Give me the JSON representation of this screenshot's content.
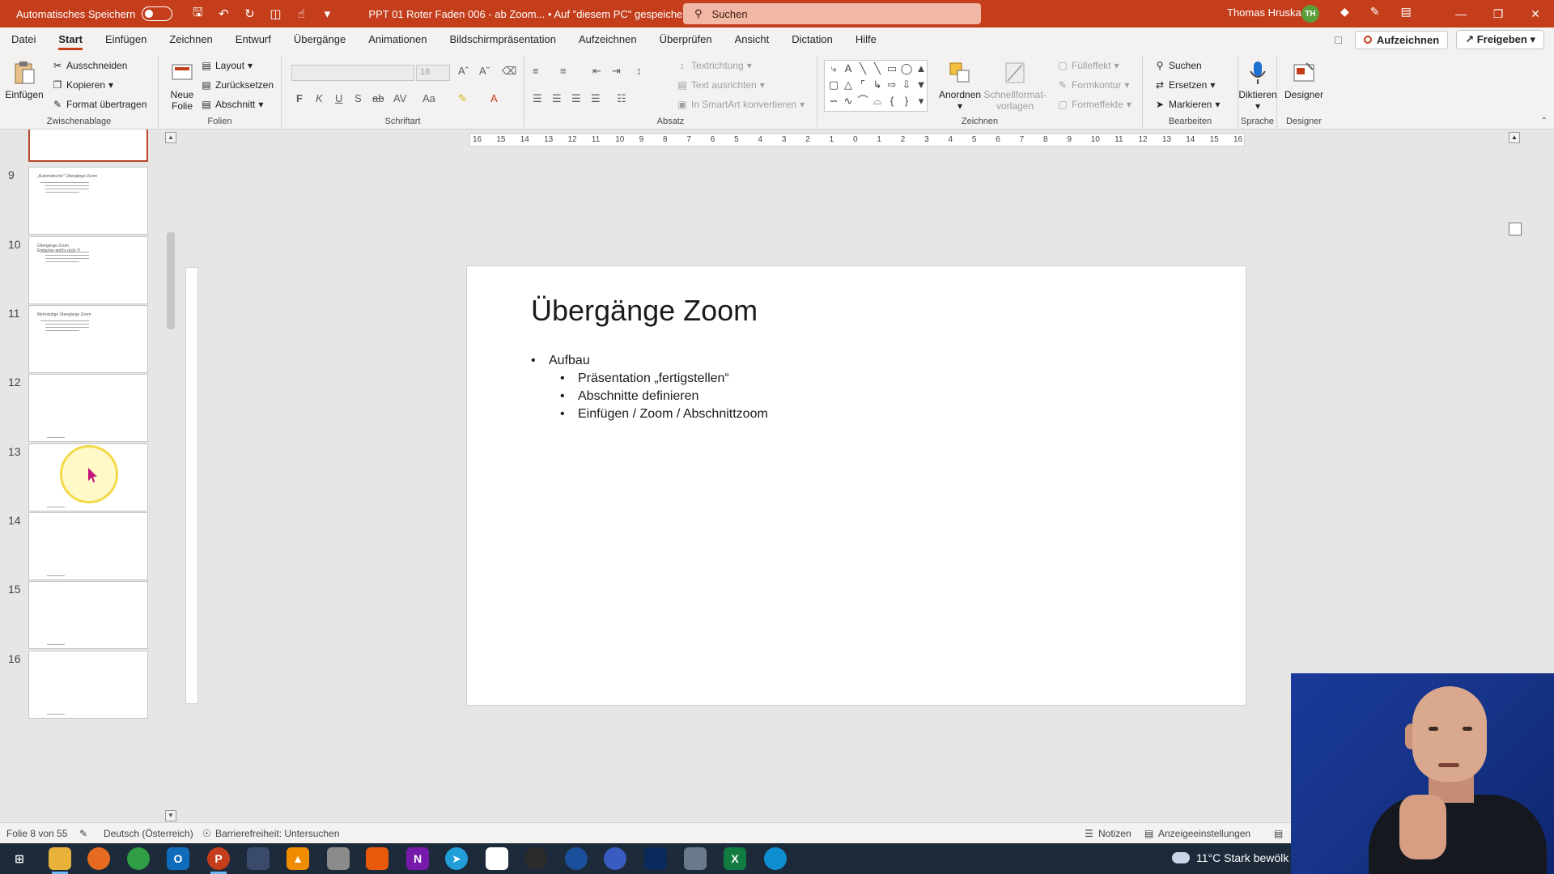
{
  "titlebar": {
    "autosave_label": "Automatisches Speichern",
    "doc_title": "PPT 01 Roter Faden 006 - ab Zoom...  •  Auf \"diesem PC\" gespeichert",
    "search_placeholder": "Suchen",
    "user_name": "Thomas Hruska",
    "user_initials": "TH",
    "accent_color": "#c43e1c"
  },
  "menu": {
    "tabs": [
      "Datei",
      "Start",
      "Einfügen",
      "Zeichnen",
      "Entwurf",
      "Übergänge",
      "Animationen",
      "Bildschirmpräsentation",
      "Aufzeichnen",
      "Überprüfen",
      "Ansicht",
      "Dictation",
      "Hilfe"
    ],
    "active_tab": "Start",
    "record_label": "Aufzeichnen",
    "share_label": "Freigeben"
  },
  "ribbon": {
    "clipboard": {
      "label": "Zwischenablage",
      "paste": "Einfügen",
      "cut": "Ausschneiden",
      "copy": "Kopieren",
      "format_painter": "Format übertragen"
    },
    "slides": {
      "label": "Folien",
      "new_slide_1": "Neue",
      "new_slide_2": "Folie",
      "layout": "Layout",
      "reset": "Zurücksetzen",
      "section": "Abschnitt"
    },
    "font": {
      "label": "Schriftart",
      "size": "18",
      "bold": "F",
      "italic": "K",
      "underline": "U",
      "shadow": "S",
      "strike": "ab",
      "spacing": "AV",
      "case": "Aa"
    },
    "paragraph": {
      "label": "Absatz",
      "text_direction": "Textrichtung",
      "align_text": "Text ausrichten",
      "smartart": "In SmartArt konvertieren"
    },
    "drawing": {
      "label": "Zeichnen",
      "arrange": "Anordnen",
      "quick_styles_1": "Schnellformat-",
      "quick_styles_2": "vorlagen",
      "fill": "Fülleffekt",
      "outline": "Formkontur",
      "effects": "Formeffekte"
    },
    "editing": {
      "label": "Bearbeiten",
      "find": "Suchen",
      "replace": "Ersetzen",
      "select": "Markieren"
    },
    "voice": {
      "label": "Sprache",
      "dictate": "Diktieren"
    },
    "designer": {
      "label": "Designer",
      "designer": "Designer"
    }
  },
  "thumbnails": [
    {
      "num": "",
      "title": "",
      "selected": true
    },
    {
      "num": "9",
      "title": "„Automatische\" Übergänge Zoom",
      "selected": false
    },
    {
      "num": "10",
      "title": "Übergänge Zoom\nEinfacher geht's nicht !!!",
      "selected": false
    },
    {
      "num": "11",
      "title": "Mehrstufige Übergänge Zoom",
      "selected": false
    },
    {
      "num": "12",
      "title": "",
      "selected": false
    },
    {
      "num": "13",
      "title": "",
      "selected": false
    },
    {
      "num": "14",
      "title": "",
      "selected": false
    },
    {
      "num": "15",
      "title": "",
      "selected": false
    },
    {
      "num": "16",
      "title": "",
      "selected": false
    }
  ],
  "ruler": {
    "h_ticks": [
      "16",
      "15",
      "14",
      "13",
      "12",
      "11",
      "10",
      "9",
      "8",
      "7",
      "6",
      "5",
      "4",
      "3",
      "2",
      "1",
      "0",
      "1",
      "2",
      "3",
      "4",
      "5",
      "6",
      "7",
      "8",
      "9",
      "10",
      "11",
      "12",
      "13",
      "14",
      "15",
      "16"
    ]
  },
  "slide": {
    "title": "Übergänge Zoom",
    "bullets": [
      {
        "level": 1,
        "text": "Aufbau"
      },
      {
        "level": 2,
        "text": "Präsentation „fertigstellen“"
      },
      {
        "level": 2,
        "text": "Abschnitte definieren"
      },
      {
        "level": 2,
        "text": "Einfügen / Zoom / Abschnittzoom"
      }
    ]
  },
  "statusbar": {
    "slide_info": "Folie 8 von 55",
    "language": "Deutsch (Österreich)",
    "accessibility": "Barrierefreiheit: Untersuchen",
    "notes": "Notizen",
    "display_settings": "Anzeigeeinstellungen"
  },
  "taskbar": {
    "weather": "11°C  Stark bewölk"
  }
}
